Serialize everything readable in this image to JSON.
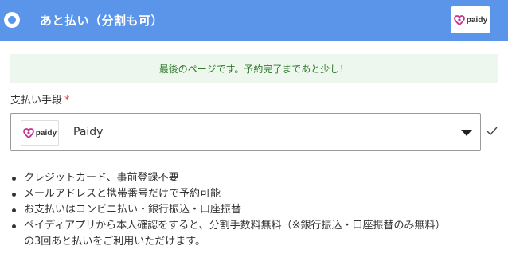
{
  "header": {
    "title": "あと払い（分割も可）",
    "logo_text": "paidy",
    "accent_color": "#5b95ea"
  },
  "notice": {
    "text": "最後のページです。予約完了まであと少し！"
  },
  "payment": {
    "label": "支払い手段",
    "required_mark": "*",
    "selected_value": "Paidy",
    "logo_text": "paidy"
  },
  "icons": {
    "radio": "radio-selected-icon",
    "caret": "caret-down-icon",
    "check": "check-icon",
    "brand": "paidy-logo-icon"
  },
  "bullets": [
    "クレジットカード、事前登録不要",
    "メールアドレスと携帯番号だけで予約可能",
    "お支払いはコンビニ払い・銀行振込・口座振替",
    "ペイディアプリから本人確認をすると、分割手数料無料（※銀行振込・口座振替のみ無料）の3回あと払いをご利用いただけます。"
  ],
  "bullet_line4_a": "ペイディアプリから本人確認をすると、分割手数料無料（※銀行振込・口座振替のみ無料）",
  "bullet_line4_b": "の3回あと払いをご利用いただけます。"
}
